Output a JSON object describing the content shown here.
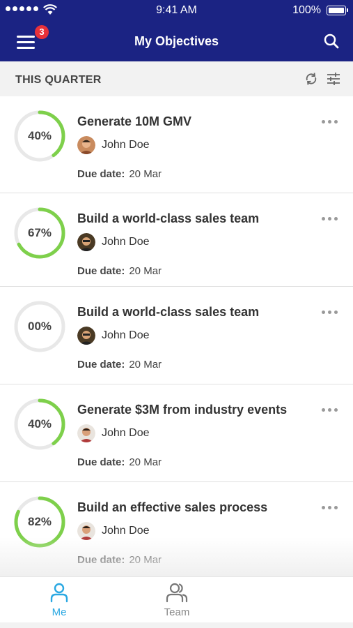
{
  "status_bar": {
    "time": "9:41 AM",
    "battery": "100%"
  },
  "nav": {
    "title": "My Objectives",
    "notification_count": "3"
  },
  "section": {
    "label": "THIS QUARTER"
  },
  "due_label": "Due date:",
  "objectives": [
    {
      "title": "Generate 10M GMV",
      "progress_label": "40%",
      "progress": 0.4,
      "owner": "John Doe",
      "due_date": "20 Mar"
    },
    {
      "title": "Build a world-class sales team",
      "progress_label": "67%",
      "progress": 0.67,
      "owner": "John Doe",
      "due_date": "20 Mar"
    },
    {
      "title": "Build a world-class sales team",
      "progress_label": "00%",
      "progress": 0.0,
      "owner": "John Doe",
      "due_date": "20 Mar"
    },
    {
      "title": "Generate $3M from industry events",
      "progress_label": "40%",
      "progress": 0.4,
      "owner": "John Doe",
      "due_date": "20 Mar"
    },
    {
      "title": "Build an effective sales process",
      "progress_label": "82%",
      "progress": 0.82,
      "owner": "John Doe",
      "due_date": "20 Mar"
    }
  ],
  "tabs": [
    {
      "label": "Me",
      "icon": "person-icon",
      "active": true
    },
    {
      "label": "Team",
      "icon": "team-icon",
      "active": false
    }
  ],
  "colors": {
    "nav": "#1b2383",
    "progress": "#7ed04b",
    "track": "#e8e8e8",
    "active_tab": "#2aa8e2",
    "badge": "#e8313a"
  }
}
